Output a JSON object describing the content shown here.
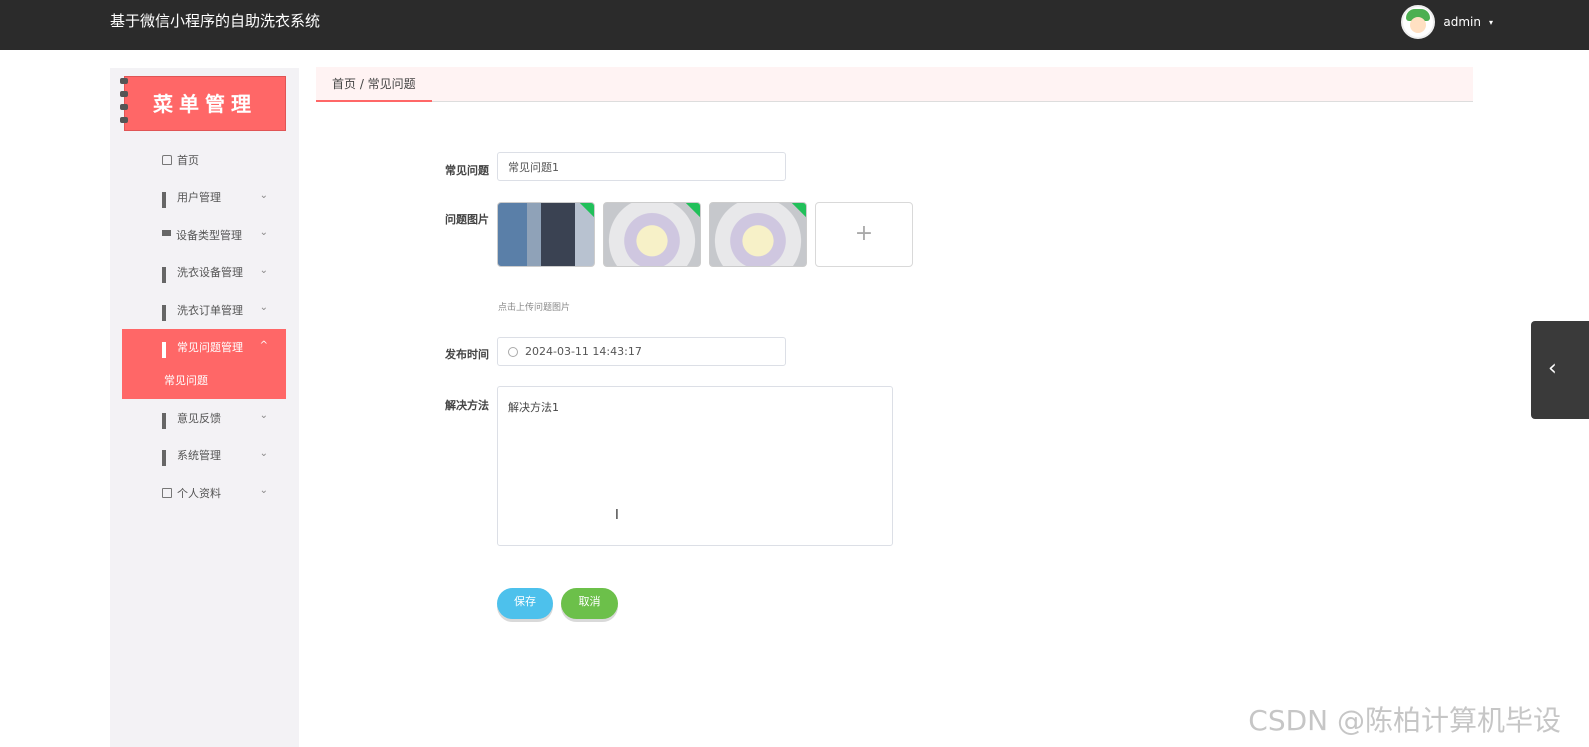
{
  "header": {
    "title": "基于微信小程序的自助洗衣系统",
    "username": "admin",
    "caret": "▾"
  },
  "sidebar": {
    "banner": "菜单管理",
    "items": [
      {
        "label": "首页",
        "icon": "home-icon"
      },
      {
        "label": "用户管理",
        "icon": "grid-icon"
      },
      {
        "label": "设备类型管理",
        "icon": "monitor-icon"
      },
      {
        "label": "洗衣设备管理",
        "icon": "grid-icon"
      },
      {
        "label": "洗衣订单管理",
        "icon": "grid-icon"
      },
      {
        "label": "常见问题管理",
        "icon": "grid-icon",
        "active": true
      },
      {
        "label": "常见问题",
        "submenu": true
      },
      {
        "label": "意见反馈",
        "icon": "grid-icon"
      },
      {
        "label": "系统管理",
        "icon": "grid-icon"
      },
      {
        "label": "个人资料",
        "icon": "card-icon"
      }
    ]
  },
  "breadcrumb": "首页 / 常见问题",
  "form": {
    "question_label": "常见问题",
    "question_value": "常见问题1",
    "images_label": "问题图片",
    "upload_hint": "点击上传问题图片",
    "upload_plus": "+",
    "publish_label": "发布时间",
    "publish_value": "2024-03-11 14:43:17",
    "solution_label": "解决方法",
    "solution_value": "解决方法1",
    "save_label": "保存",
    "cancel_label": "取消"
  },
  "colors": {
    "accent": "#ff6767",
    "save": "#4dc1ec",
    "cancel": "#6cc04a",
    "topbar": "#2b2b2b"
  },
  "watermark": "CSDN @陈柏计算机毕设",
  "side_toggle": "‹"
}
